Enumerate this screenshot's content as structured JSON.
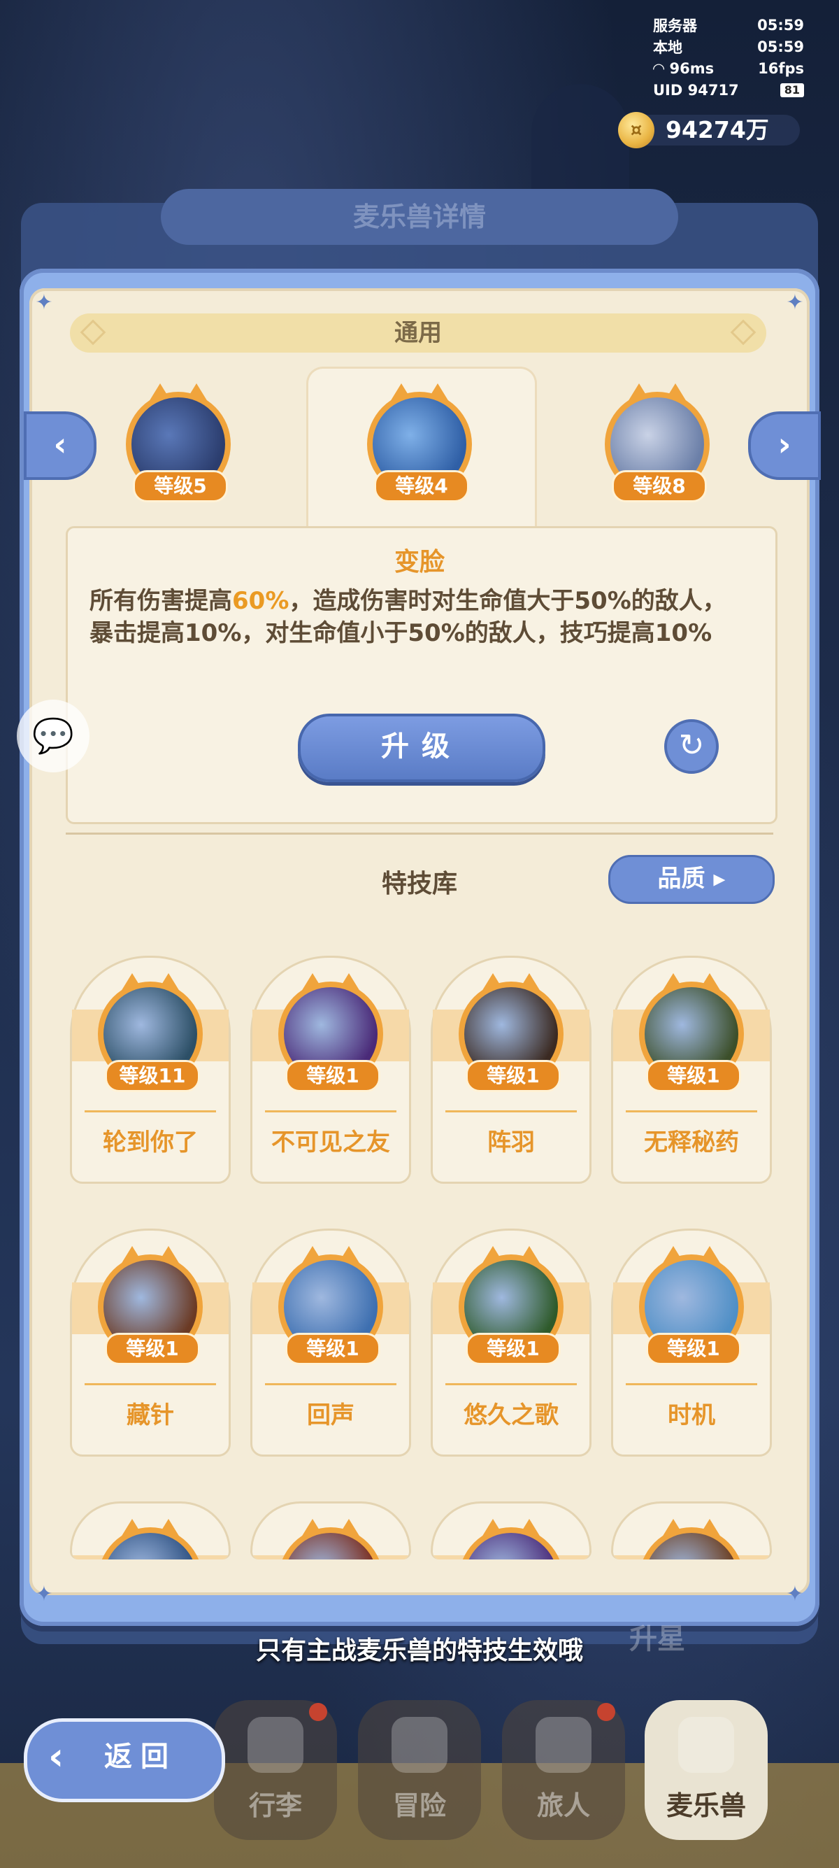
{
  "status": {
    "server_label": "服务器",
    "server_time": "05:59",
    "local_label": "本地",
    "local_time": "05:59",
    "ping": "96ms",
    "fps": "16fps",
    "uid": "UID 94717",
    "battery": "81"
  },
  "currency": {
    "gold": "94274万",
    "icon": "coin-icon"
  },
  "back_panel": {
    "title": "麦乐兽详情"
  },
  "panel": {
    "header": "通用",
    "pets": [
      {
        "level": "等级5",
        "color": "#2b3d6e"
      },
      {
        "level": "等级4",
        "color": "#2f5fa6"
      },
      {
        "level": "等级8",
        "color": "#6b7fa8"
      }
    ],
    "skill": {
      "name": "变脸",
      "desc_a": "所有伤害提高",
      "desc_hl": "60%",
      "desc_b": "，造成伤害时对生命值大于50%的敌人，暴击提高10%，对生命值小于50%的敌人，技巧提高10%"
    },
    "upgrade_label": "升级",
    "library_title": "特技库",
    "quality_label": "品质"
  },
  "cards": [
    {
      "name": "轮到你了",
      "level": "等级11",
      "color": "#2c4f66"
    },
    {
      "name": "不可见之友",
      "level": "等级1",
      "color": "#4a2a78"
    },
    {
      "name": "阵羽",
      "level": "等级1",
      "color": "#3b2a22"
    },
    {
      "name": "无释秘药",
      "level": "等级1",
      "color": "#3c4f2a"
    },
    {
      "name": "藏针",
      "level": "等级1",
      "color": "#6b3a24"
    },
    {
      "name": "回声",
      "level": "等级1",
      "color": "#3d6fb0"
    },
    {
      "name": "悠久之歌",
      "level": "等级1",
      "color": "#2e5a2a"
    },
    {
      "name": "时机",
      "level": "等级1",
      "color": "#4f8fc6"
    },
    {
      "name": "",
      "level": "",
      "color": "#2c4f80"
    },
    {
      "name": "",
      "level": "",
      "color": "#7a2a1a"
    },
    {
      "name": "",
      "level": "",
      "color": "#4a2a78"
    },
    {
      "name": "",
      "level": "",
      "color": "#6a3a1a"
    }
  ],
  "hint": "只有主战麦乐兽的特技生效哦",
  "back_button": "返回",
  "ghost_button": "升星",
  "tabs": [
    {
      "label": "",
      "badge": true
    },
    {
      "label": "行李",
      "badge": true
    },
    {
      "label": "冒险",
      "badge": false
    },
    {
      "label": "旅人",
      "badge": true
    },
    {
      "label": "麦乐兽",
      "badge": false
    }
  ]
}
